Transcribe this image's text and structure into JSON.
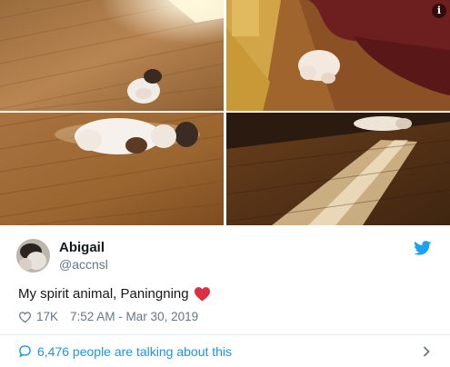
{
  "media": {
    "info_glyph": "i",
    "photos": [
      {
        "alt_icon": "photo-floor-puppy-far"
      },
      {
        "alt_icon": "photo-puppy-near-person"
      },
      {
        "alt_icon": "photo-puppy-close"
      },
      {
        "alt_icon": "photo-puppy-distant"
      }
    ]
  },
  "tweet": {
    "display_name": "Abigail",
    "handle": "@accnsl",
    "text": "My spirit animal, Paningning",
    "likes": "17K",
    "timestamp": "7:52 AM - Mar 30, 2019",
    "conversation": "6,476 people are talking about this"
  },
  "colors": {
    "accent": "#1b95e0",
    "twitter_blue": "#1da1f2",
    "heart_red": "#e0245e",
    "muted": "#657786"
  },
  "icons": {
    "brand": "twitter-bird-icon",
    "like": "heart-outline-icon",
    "emoji": "red-heart-emoji-icon",
    "conversation": "speech-bubble-icon",
    "chevron": "chevron-right-icon"
  }
}
